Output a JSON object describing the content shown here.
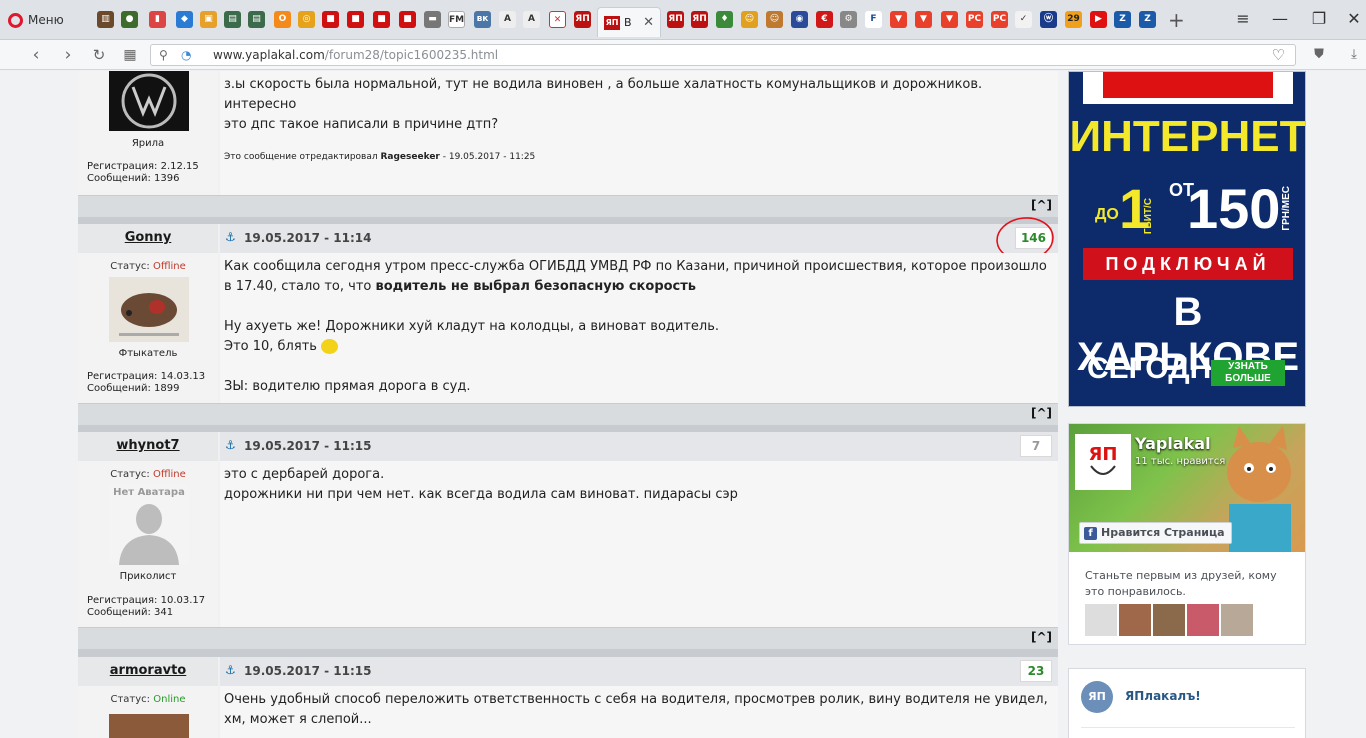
{
  "browser": {
    "menu_label": "Меню",
    "active_tab_label": "B",
    "url_domain": "www.yaplakal.com",
    "url_path": "/forum28/topic1600235.html"
  },
  "posts": [
    {
      "text_lines": [
        "з.ы скорость была нормальной, тут не водила виновен , а больше халатность комунальщиков и дорожников. интересно",
        "это дпс такое написали в причине дтп?"
      ],
      "edit_prefix": "Это сообщение отредактировал ",
      "edit_author": "Rageseeker",
      "edit_suffix": " - 19.05.2017 - 11:25",
      "user_title": "Ярила",
      "reg": "Регистрация: 2.12.15",
      "msgs": "Сообщений: 1396",
      "up": "[^]"
    },
    {
      "name": "Gonny",
      "date": "19.05.2017 - 11:14",
      "rating": "146",
      "status_label": "Статус: ",
      "status": "Offline",
      "user_title": "Фтыкатель",
      "reg": "Регистрация: 14.03.13",
      "msgs": "Сообщений: 1899",
      "line1": "Как сообщила сегодня утром пресс-служба ОГИБДД УМВД РФ по Казани, причиной происшествия, которое произошло",
      "line2_a": "в 17.40, стало то, что ",
      "line2_b": "водитель не выбрал безопасную скорость",
      "line3": "Ну ахуеть же! Дорожники хуй кладут на колодцы, а виноват водитель.",
      "line4": "Это 10, блять",
      "line5": "ЗЫ: водителю прямая дорога в суд.",
      "up": "[^]"
    },
    {
      "name": "whynot7",
      "date": "19.05.2017 - 11:15",
      "rating": "7",
      "status_label": "Статус: ",
      "status": "Offline",
      "avatar_text": "Нет Аватара",
      "user_title": "Приколист",
      "reg": "Регистрация: 10.03.17",
      "msgs": "Сообщений: 341",
      "line1": "это с дербарей дорога.",
      "line2": "дорожники ни при чем нет. как всегда водила сам виноват. пидарасы сэр",
      "up": "[^]"
    },
    {
      "name": "armoravto",
      "date": "19.05.2017 - 11:15",
      "rating": "23",
      "status_label": "Статус: ",
      "status": "Online",
      "line1": "Очень удобный способ переложить ответственность с себя на водителя, просмотрев ролик, вину водителя не увидел,",
      "line2": "хм, может я слепой..."
    }
  ],
  "ad": {
    "line_internet": "ИНТЕРНЕТ",
    "line_do": "ДО",
    "line_speed": "1",
    "line_gbit": "ГБИТ/С",
    "line_ot": "ОТ",
    "line_price": "150",
    "line_grn": "ГРН/МЕС",
    "line_connect": "ПОДКЛЮЧАЙ",
    "line_city": "В ХАРЬКОВЕ",
    "line_today": "СЕГОДНЯ",
    "btn": "УЗНАТЬ БОЛЬШЕ"
  },
  "fb": {
    "page_name": "Yaplakal",
    "likes": "11 тыс. нравится",
    "like_btn": "Нравится Страница",
    "text": "Станьте первым из друзей, кому это понравилось."
  },
  "vk": {
    "name": "ЯПлакалъ!"
  },
  "colors": {
    "rating_green": "#2a8a2a",
    "offline_red": "#c0392b",
    "online_green": "#2a9a2a",
    "annotation_red": "#e0101a"
  }
}
